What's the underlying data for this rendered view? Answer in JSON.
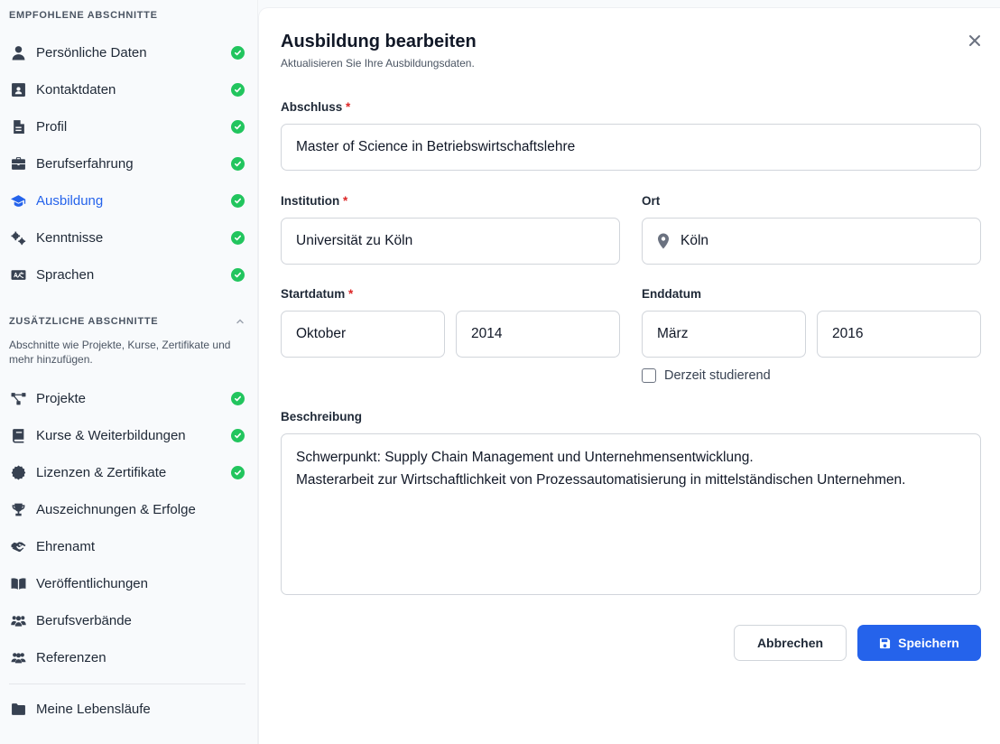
{
  "sidebar": {
    "recommended_heading": "EMPFOHLENE ABSCHNITTE",
    "recommended": [
      {
        "label": "Persönliche Daten",
        "icon": "person-icon",
        "done": true
      },
      {
        "label": "Kontaktdaten",
        "icon": "contact-card-icon",
        "done": true
      },
      {
        "label": "Profil",
        "icon": "document-icon",
        "done": true
      },
      {
        "label": "Berufserfahrung",
        "icon": "briefcase-icon",
        "done": true
      },
      {
        "label": "Ausbildung",
        "icon": "graduation-cap-icon",
        "done": true,
        "active": true
      },
      {
        "label": "Kenntnisse",
        "icon": "gears-icon",
        "done": true
      },
      {
        "label": "Sprachen",
        "icon": "language-icon",
        "done": true
      }
    ],
    "extra_heading": "ZUSÄTZLICHE ABSCHNITTE",
    "extra_description": "Abschnitte wie Projekte, Kurse, Zertifikate und mehr hinzufügen.",
    "extra": [
      {
        "label": "Projekte",
        "icon": "project-diagram-icon",
        "done": true
      },
      {
        "label": "Kurse & Weiterbildungen",
        "icon": "book-icon",
        "done": true
      },
      {
        "label": "Lizenzen & Zertifikate",
        "icon": "certificate-icon",
        "done": true
      },
      {
        "label": "Auszeichnungen & Erfolge",
        "icon": "trophy-icon",
        "done": false
      },
      {
        "label": "Ehrenamt",
        "icon": "handshake-icon",
        "done": false
      },
      {
        "label": "Veröffentlichungen",
        "icon": "open-book-icon",
        "done": false
      },
      {
        "label": "Berufsverbände",
        "icon": "users-icon",
        "done": false
      },
      {
        "label": "Referenzen",
        "icon": "user-group-icon",
        "done": false
      }
    ],
    "resumes_label": "Meine Lebensläufe"
  },
  "modal": {
    "title": "Ausbildung bearbeiten",
    "subtitle": "Aktualisieren Sie Ihre Ausbildungsdaten.",
    "degree_label": "Abschluss",
    "degree_value": "Master of Science in Betriebswirtschaftslehre",
    "institution_label": "Institution",
    "institution_value": "Universität zu Köln",
    "location_label": "Ort",
    "location_value": "Köln",
    "start_label": "Startdatum",
    "start_month": "Oktober",
    "start_year": "2014",
    "end_label": "Enddatum",
    "end_month": "März",
    "end_year": "2016",
    "currently_studying_label": "Derzeit studierend",
    "description_label": "Beschreibung",
    "description_line1": "Schwerpunkt: Supply Chain Management und Unternehmensentwicklung.",
    "description_line2": "Masterarbeit zur Wirtschaftlichkeit von Prozessautomatisierung in mittelständischen Unternehmen.",
    "required_marker": "*",
    "cancel_label": "Abbrechen",
    "save_label": "Speichern"
  },
  "colors": {
    "accent": "#2563eb",
    "success": "#22c55e",
    "required": "#dc2626"
  }
}
